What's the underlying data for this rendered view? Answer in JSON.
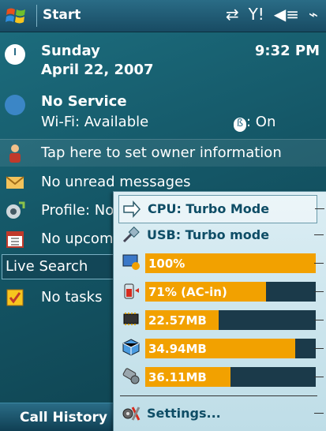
{
  "titlebar": {
    "start_label": "Start",
    "icons": [
      "sync-icon",
      "signal-icon",
      "volume-icon",
      "battery-icon"
    ]
  },
  "today": {
    "day": "Sunday",
    "date": "April 22, 2007",
    "time": "9:32 PM",
    "service": "No Service",
    "wifi": "Wi-Fi: Available",
    "bluetooth": ": On",
    "owner": "Tap here to set owner information",
    "messages": "No unread messages",
    "profile": "Profile: No",
    "appointments": "No upcom",
    "search": "Live Search",
    "tasks": "No tasks"
  },
  "softkeys": {
    "left": "Call History"
  },
  "popup": {
    "cpu_label": "CPU: Turbo Mode",
    "usb_label": "USB: Turbo mode",
    "brightness_text": "100%",
    "battery_text": "71% (AC-in)",
    "program_mem_text": "22.57MB",
    "storage_text": "34.94MB",
    "card_text": "36.11MB",
    "settings_label": "Settings...",
    "levels": {
      "brightness": 100,
      "battery": 71,
      "program_mem": 43,
      "storage": 88,
      "card": 50
    },
    "accent_color": "#f2a100"
  }
}
